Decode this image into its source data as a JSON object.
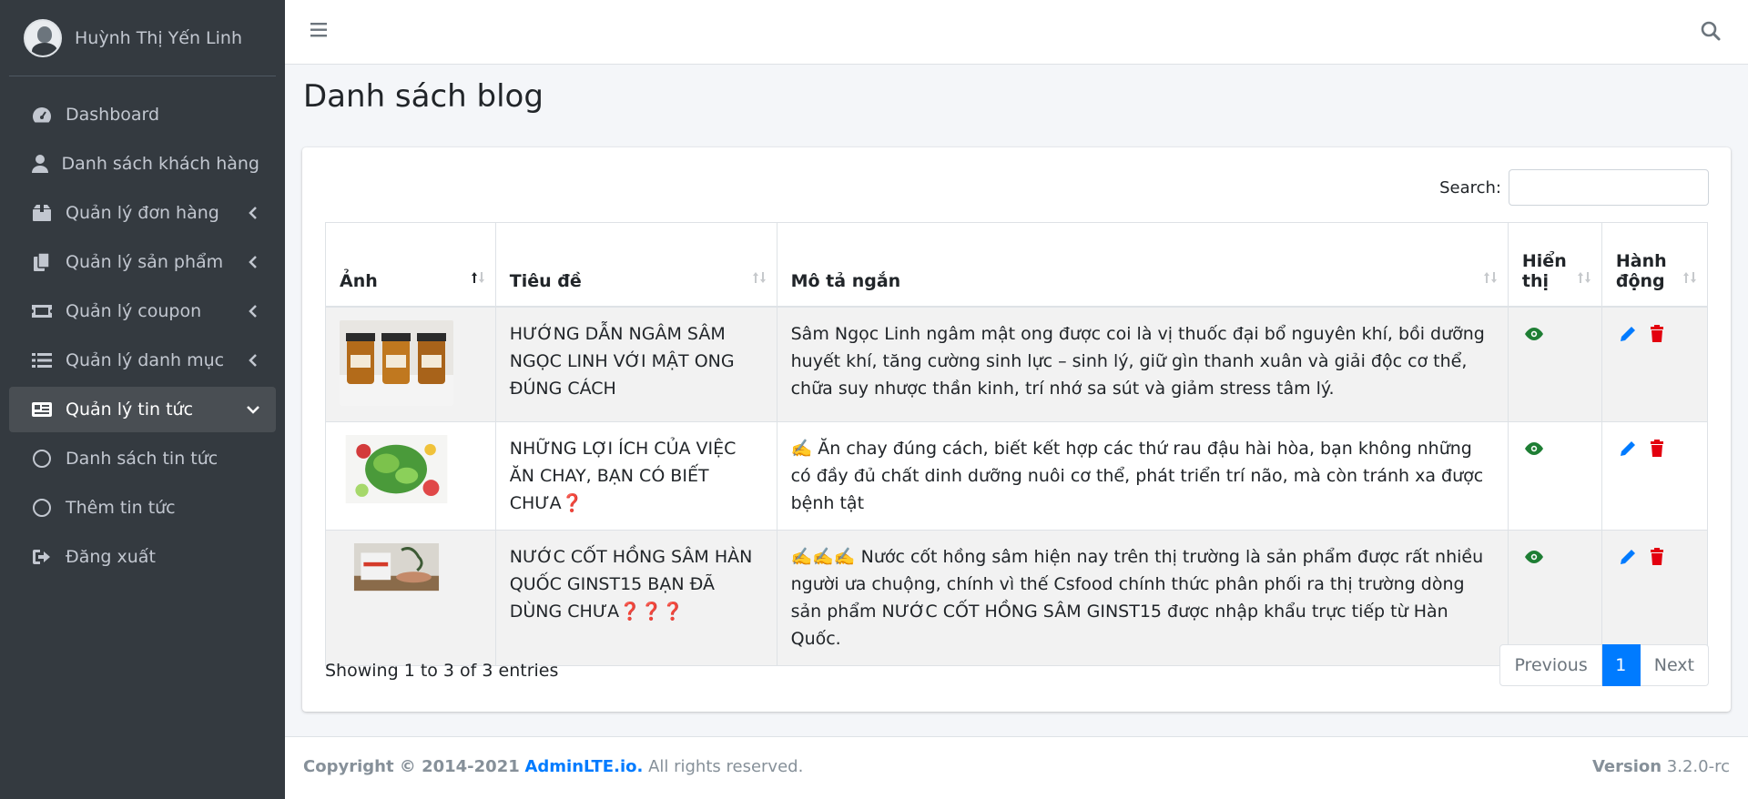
{
  "sidebar": {
    "user_name": "Huỳnh Thị Yến Linh",
    "items": [
      {
        "label": "Dashboard",
        "icon": "tachometer-icon"
      },
      {
        "label": "Danh sách khách hàng",
        "icon": "user-icon"
      },
      {
        "label": "Quản lý đơn hàng",
        "icon": "box-icon"
      },
      {
        "label": "Quản lý sản phẩm",
        "icon": "copy-icon"
      },
      {
        "label": "Quản lý coupon",
        "icon": "ticket-icon"
      },
      {
        "label": "Quản lý danh mục",
        "icon": "list-icon"
      },
      {
        "label": "Quản lý tin tức",
        "icon": "newspaper-icon"
      },
      {
        "label": "Danh sách tin tức",
        "icon": "circle-icon"
      },
      {
        "label": "Thêm tin tức",
        "icon": "circle-icon"
      },
      {
        "label": "Đăng xuất",
        "icon": "sign-out-icon"
      }
    ]
  },
  "page": {
    "title": "Danh sách blog"
  },
  "table": {
    "search_label": "Search:",
    "search_value": "",
    "headers": [
      "Ảnh",
      "Tiêu đề",
      "Mô tả ngắn",
      "Hiển thị",
      "Hành động"
    ],
    "rows": [
      {
        "title": "HƯỚNG DẪN NGÂM SÂM NGỌC LINH VỚI MẬT ONG ĐÚNG CÁCH",
        "description": "Sâm Ngọc Linh ngâm mật ong được coi là vị thuốc đại bổ nguyên khí, bồi dưỡng huyết khí, tăng cường sinh lực – sinh lý, giữ gìn thanh xuân và giải độc cơ thể, chữa suy nhược thần kinh, trí nhớ sa sút và giảm stress tâm lý."
      },
      {
        "title": "NHỮNG LỢI ÍCH CỦA VIỆC ĂN CHAY, BẠN CÓ BIẾT CHƯA❓",
        "description": "✍️ Ăn chay đúng cách, biết kết hợp các thứ rau đậu hài hòa, bạn không những có đầy đủ chất dinh dưỡng nuôi cơ thể, phát triển trí não, mà còn tránh xa được bệnh tật"
      },
      {
        "title": "NƯỚC CỐT HỒNG SÂM HÀN QUỐC GINST15 BẠN ĐÃ DÙNG CHƯA❓❓❓",
        "description": "✍️✍️✍️ Nước cốt hồng sâm hiện nay trên thị trường là sản phẩm được rất nhiều người ưa chuộng, chính vì thế Csfood chính thức phân phối ra thị trường dòng sản phẩm NƯỚC CỐT HỒNG SÂM GINST15 được nhập khẩu trực tiếp từ Hàn Quốc."
      }
    ],
    "info": "Showing 1 to 3 of 3 entries",
    "pagination": {
      "previous": "Previous",
      "current": "1",
      "next": "Next"
    }
  },
  "footer": {
    "copyright": "Copyright © 2014-2021",
    "brand": "AdminLTE.io.",
    "rights": "All rights reserved.",
    "version_label": "Version",
    "version": "3.2.0-rc"
  },
  "colors": {
    "sidebar_bg": "#343a40",
    "accent": "#007bff",
    "eye": "#1e7e34",
    "edit": "#007bff",
    "delete": "#dc3545"
  }
}
